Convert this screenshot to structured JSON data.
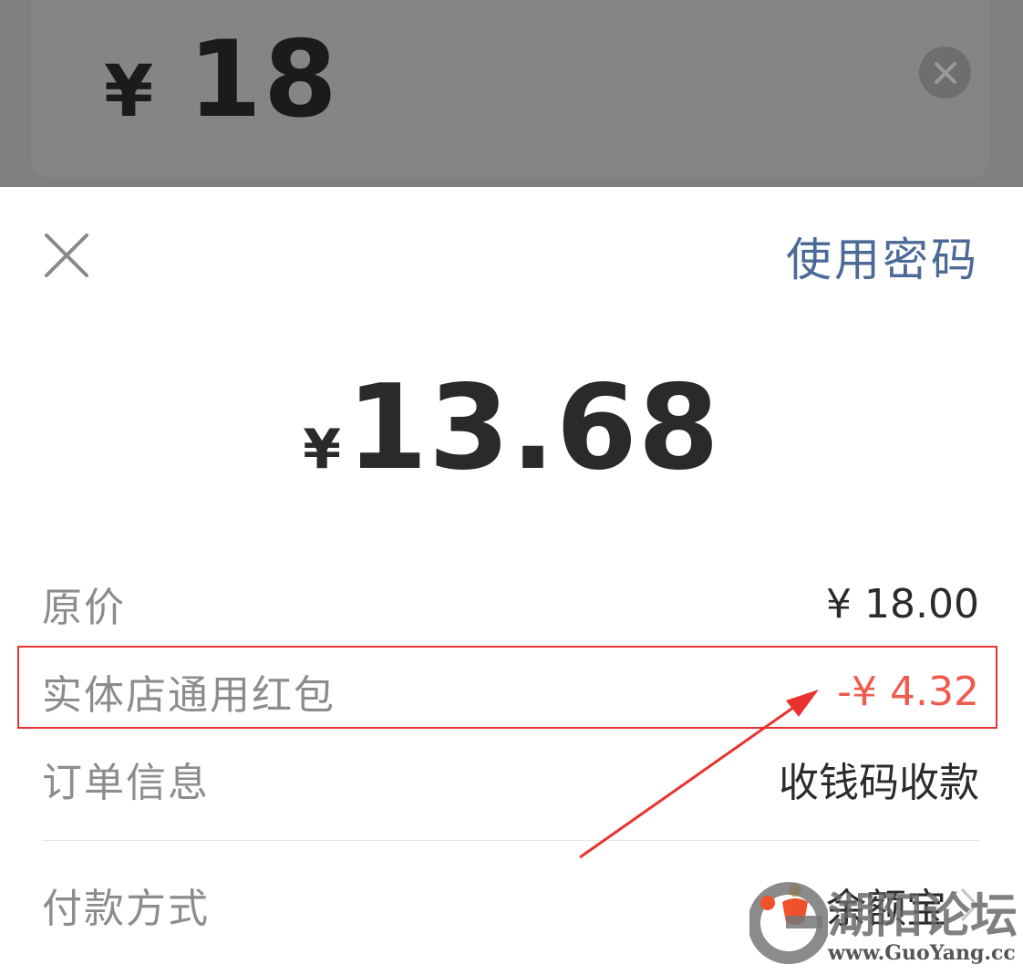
{
  "input": {
    "currency": "¥",
    "amount": "18"
  },
  "sheet": {
    "use_password": "使用密码",
    "pay_currency": "¥",
    "pay_amount": "13.68",
    "rows": {
      "original_label": "原价",
      "original_value": "¥ 18.00",
      "coupon_label": "实体店通用红包",
      "coupon_value": "-¥ 4.32",
      "order_label": "订单信息",
      "order_value": "收钱码收款",
      "payment_label": "付款方式",
      "payment_value": "余额宝"
    }
  },
  "watermark": {
    "text": "湖阳论坛",
    "url": "www.GuoYang.cc"
  },
  "colors": {
    "accent_link": "#4c6a96",
    "discount": "#ef5b4f",
    "highlight": "#e8322d"
  },
  "icons": {
    "close": "close-icon",
    "clear": "clear-input-icon",
    "chevron": "chevron-right-icon",
    "payment_logo": "yuebao-logo-icon"
  }
}
